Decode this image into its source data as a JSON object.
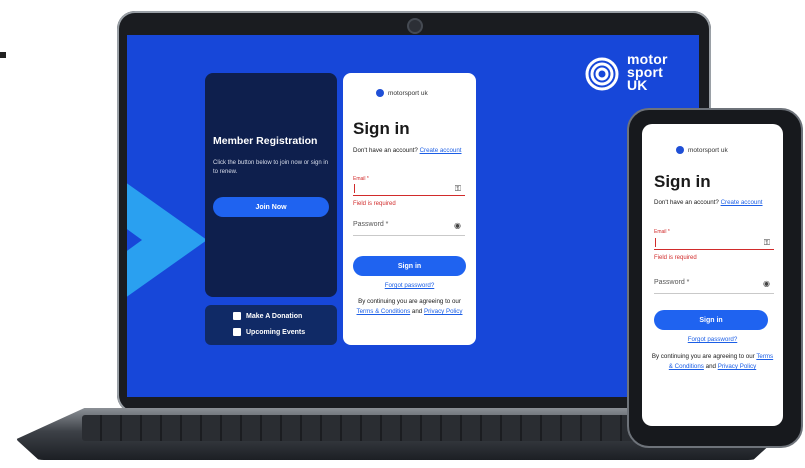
{
  "brand": {
    "line1": "motor",
    "line2": "sport",
    "line3": "UK",
    "color": "#ffffff"
  },
  "colors": {
    "screen_bg": "#1747d9",
    "accent": "#1f63f0",
    "error": "#d12b2b",
    "panel": "#0e1f4d",
    "arrow": "#2aa0f0"
  },
  "registration": {
    "title": "Member Registration",
    "description": "Click the button below to join now or sign in to renew.",
    "join_label": "Join Now",
    "links": [
      {
        "label": "Make A Donation",
        "icon": "donation-icon"
      },
      {
        "label": "Upcoming Events",
        "icon": "calendar-icon"
      }
    ]
  },
  "signin": {
    "logo_text": "motorsport uk",
    "heading": "Sign in",
    "no_account_text": "Don't have an account?",
    "create_account_label": "Create account",
    "email_label": "Email *",
    "email_value": "",
    "email_error": "Field is required",
    "password_placeholder": "Password *",
    "signin_label": "Sign in",
    "forgot_label": "Forgot password?",
    "terms_prefix": "By continuing you are agreeing to our",
    "terms_label": "Terms & Conditions",
    "terms_and": "and",
    "privacy_label": "Privacy Policy"
  }
}
